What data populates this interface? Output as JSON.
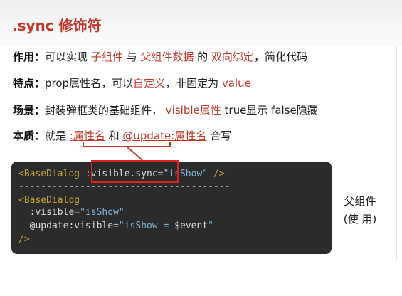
{
  "title": ".sync 修饰符",
  "line1": {
    "label": "作用：",
    "t1": "可以实现 ",
    "h1": "子组件",
    "t2": " 与 ",
    "h2": "父组件数据",
    "t3": " 的 ",
    "h3": "双向绑定",
    "t4": "，简化代码"
  },
  "line2": {
    "label": "特点：",
    "t1": "prop属性名，可以",
    "h1": "自定义",
    "t2": "，非固定为 ",
    "h2": "value"
  },
  "line3": {
    "label": "场景：",
    "t1": "封装弹框类的基础组件， ",
    "h1": "visible属性",
    "t2": "  true显示 false隐藏"
  },
  "line4": {
    "label": "本质：",
    "t1": "就是 ",
    "h1": ":属性名",
    "t2": " 和 ",
    "h2": "@update:属性名",
    "t3": " 合写"
  },
  "code": {
    "l1_tag": "<BaseDialog",
    "l1_attr": ":visible.sync",
    "l1_eq": "=",
    "l1_val": "\"isShow\"",
    "l1_end": " />",
    "divider": "--------------------------------------",
    "l3_tag": "<BaseDialog",
    "l4_attr": ":visible",
    "l4_eq": "=",
    "l4_val": "\"isShow\"",
    "l5_attr": "@update:visible",
    "l5_eq": "=",
    "l5_val": "\"isShow = ",
    "l5_var": "$event",
    "l5_q": "\"",
    "l6": "/>"
  },
  "side": {
    "line1": "父组件",
    "line2": "(使 用)"
  },
  "colors": {
    "accent": "#c0392b",
    "highlight_box": "#e02020",
    "code_bg": "#2b2b2b"
  }
}
